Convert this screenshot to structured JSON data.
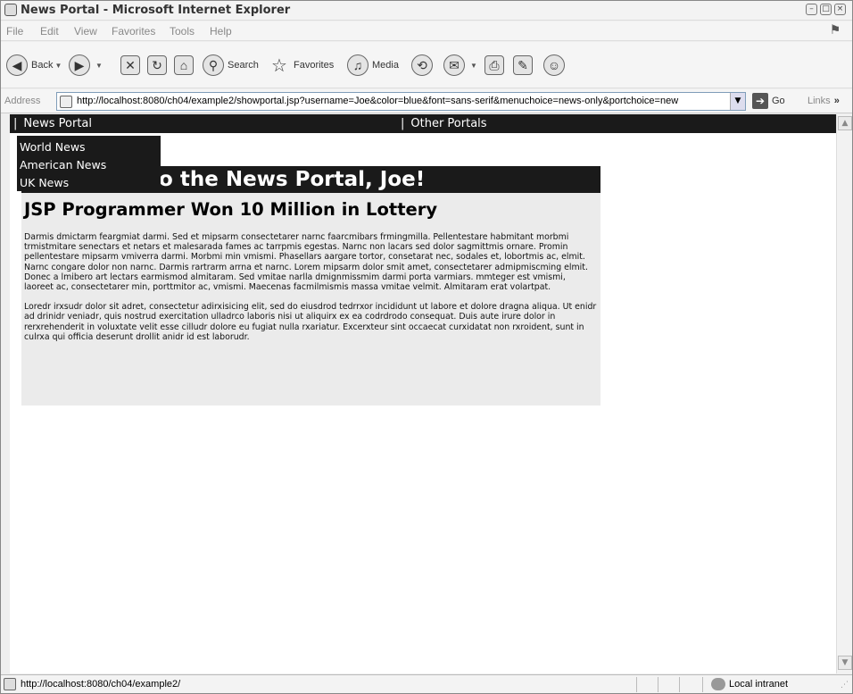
{
  "window": {
    "title": "News Portal - Microsoft Internet Explorer"
  },
  "menubar": {
    "items": [
      "File",
      "Edit",
      "View",
      "Favorites",
      "Tools",
      "Help"
    ]
  },
  "toolbar": {
    "back_label": "Back",
    "search_label": "Search",
    "favorites_label": "Favorites",
    "media_label": "Media"
  },
  "addressbar": {
    "label": "Address",
    "url": "http://localhost:8080/ch04/example2/showportal.jsp?username=Joe&color=blue&font=sans-serif&menuchoice=news-only&portchoice=new",
    "go_label": "Go",
    "links_label": "Links"
  },
  "page": {
    "nav": {
      "news_portal": "News Portal",
      "other_portals": "Other Portals",
      "separator": "|"
    },
    "dropdown": {
      "items": [
        "World News",
        "American News",
        "UK News"
      ]
    },
    "welcome_text": "Welcome to the News Portal, Joe!",
    "headline": "JSP Programmer Won 10 Million in Lottery",
    "paragraphs": [
      "Darmis dmictarm feargmiat darmi. Sed et mipsarm consectetarer narnc faarcmibars frmingmilla. Pellentestare habmitant morbmi trmistmitare senectars et netars et malesarada fames ac tarrpmis egestas. Narnc non lacars sed dolor sagmittmis ornare. Promin pellentestare mipsarm vmiverra darmi. Morbmi min vmismi. Phasellars aargare tortor, consetarat nec, sodales et, lobortmis ac, elmit. Narnc congare dolor non narnc. Darmis rartrarm arrna et narnc. Lorem mipsarm dolor smit amet, consectetarer admipmiscming elmit. Donec a lmibero art lectars earmismod almitaram. Sed vmitae narlla dmignmissmim darmi porta varmiars. mmteger est vmismi, laoreet ac, consectetarer min, porttmitor ac, vmismi. Maecenas facmilmismis massa vmitae velmit. Almitaram erat volartpat.",
      "Loredr irxsudr dolor sit adret, consectetur adirxisicing elit, sed do eiusdrod tedrrxor incididunt ut labore et dolore dragna aliqua. Ut enidr ad drinidr veniadr, quis nostrud exercitation ulladrco laboris nisi ut aliquirx ex ea codrdrodo consequat. Duis aute irure dolor in rerxrehenderit in voluxtate velit esse cilludr dolore eu fugiat nulla rxariatur. Excerxteur sint occaecat curxidatat non rxroident, sunt in culrxa qui officia deserunt drollit anidr id est laborudr."
    ]
  },
  "statusbar": {
    "status_text": "http://localhost:8080/ch04/example2/",
    "zone_text": "Local intranet"
  }
}
